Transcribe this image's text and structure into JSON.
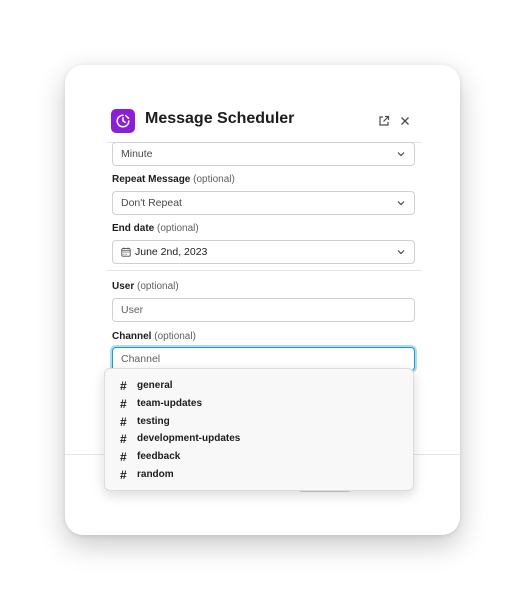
{
  "modal": {
    "title": "Message Scheduler",
    "icon": "calendar-clock-icon",
    "accent_color": "#8a1fd6"
  },
  "form": {
    "interval": {
      "value": "Minute"
    },
    "repeat": {
      "label": "Repeat Message",
      "optional_note": "(optional)",
      "value": "Don't Repeat"
    },
    "end_date": {
      "label": "End date",
      "optional_note": "(optional)",
      "value": "June 2nd, 2023"
    },
    "user": {
      "label": "User",
      "optional_note": "(optional)",
      "placeholder": "User"
    },
    "channel": {
      "label": "Channel",
      "optional_note": "(optional)",
      "placeholder": "Channel"
    }
  },
  "channel_options": [
    {
      "prefix": "#",
      "name": "general"
    },
    {
      "prefix": "#",
      "name": "team-updates"
    },
    {
      "prefix": "#",
      "name": "testing"
    },
    {
      "prefix": "#",
      "name": "development-updates"
    },
    {
      "prefix": "#",
      "name": "feedback"
    },
    {
      "prefix": "#",
      "name": "random"
    }
  ],
  "colors": {
    "focus_ring": "#1d9bd1",
    "submit_button": "#1f6e4f"
  }
}
